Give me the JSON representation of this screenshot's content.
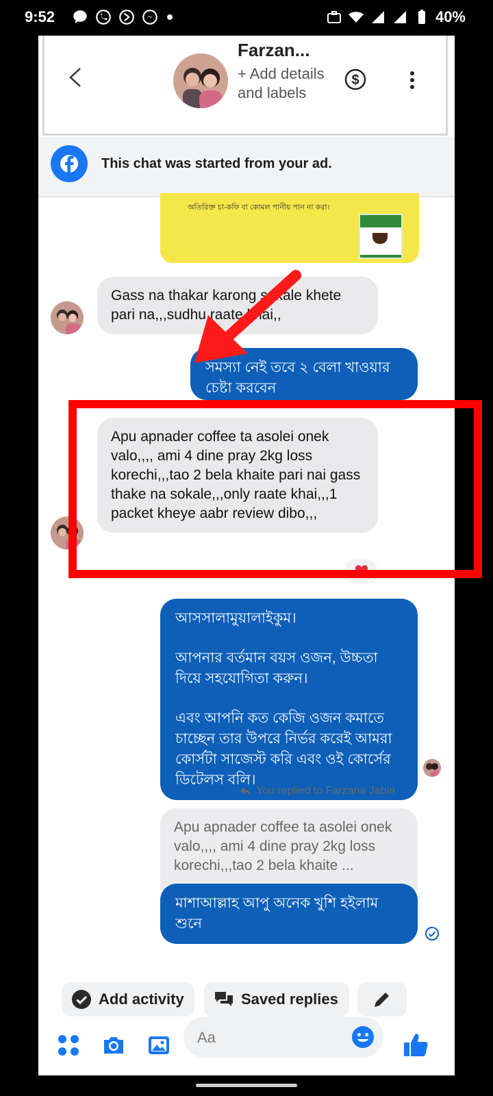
{
  "status_bar": {
    "time": "9:52",
    "battery": "40%"
  },
  "header": {
    "contact_name": "Farzan...",
    "subtitle": "+ Add details and labels"
  },
  "ad_banner": {
    "text": "This chat was started from your ad.",
    "image_line": "অতিরিক্ত চা-কফি বা কোমল পানীয় পান না করা।"
  },
  "messages": {
    "m1": "Gass na thakar karong sokale khete pari na,,,sudhu raate khai,,",
    "m2": "সমস্যা নেই তবে ২ বেলা খাওয়ার চেষ্টা করবেন",
    "m3": "Apu apnader coffee ta asolei onek valo,,,, ami 4 dine pray 2kg loss korechi,,,tao 2 bela khaite pari nai gass thake na sokale,,,only raate khai,,,1 packet  kheye aabr review dibo,,,",
    "m4_p1": "আসসালামুয়ালাইকুম।",
    "m4_p2": "আপনার বর্তমান বয়স ওজন, উচ্চতা দিয়ে সহযোগিতা করুন।",
    "m4_p3": "এবং আপনি কত কেজি ওজন কমাতে চাচ্ছেন তার উপরে নির্ভর করেই আমরা কোর্সটা সাজেস্ট করি এবং ওই কোর্সের ডিটেলস বলি।",
    "reply_note": "You replied to Farzana Jabin",
    "quoted": "Apu apnader coffee ta asolei onek valo,,,, ami 4 dine pray 2kg loss korechi,,,tao 2 bela khaite ...",
    "m5": "মাশাআল্লাহ আপু অনেক খুশি হইলাম শুনে"
  },
  "actions": {
    "add_activity": "Add activity",
    "saved_replies": "Saved replies"
  },
  "composer": {
    "placeholder": "Aa"
  },
  "colors": {
    "outgoing_bubble": "#0d5fb8",
    "incoming_bubble": "#e9e9eb",
    "annotation_red": "#ff0000",
    "brand_blue": "#1877f2"
  }
}
